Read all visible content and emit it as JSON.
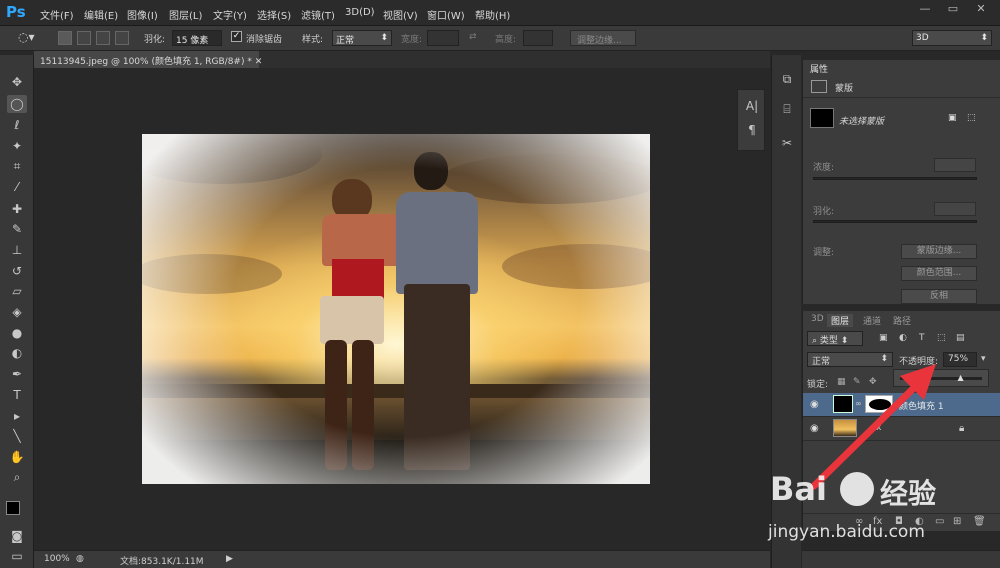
{
  "app": {
    "logo": "Ps",
    "accent": "#31a8ff"
  },
  "menu": [
    {
      "label": "文件(F)"
    },
    {
      "label": "编辑(E)"
    },
    {
      "label": "图像(I)"
    },
    {
      "label": "图层(L)"
    },
    {
      "label": "文字(Y)"
    },
    {
      "label": "选择(S)"
    },
    {
      "label": "滤镜(T)"
    },
    {
      "label": "3D(D)"
    },
    {
      "label": "视图(V)"
    },
    {
      "label": "窗口(W)"
    },
    {
      "label": "帮助(H)"
    }
  ],
  "window_controls": {
    "minimize": "—",
    "restore": "▭",
    "close": "✕"
  },
  "options": {
    "feather_label": "羽化:",
    "feather_value": "15 像素",
    "antialias_label": "消除锯齿",
    "antialias_checked": true,
    "style_label": "样式:",
    "style_value": "正常",
    "width_label": "宽度:",
    "height_label": "高度:",
    "refine_edge": "调整边缘...",
    "workspace": "3D"
  },
  "document": {
    "tab_label": "15113945.jpeg @ 100% (颜色填充 1, RGB/8#) *",
    "zoom": "100%",
    "doc_size": "文档:853.1K/1.11M"
  },
  "properties": {
    "tab": "属性",
    "mask_type": "蒙版",
    "mask_status": "未选择蒙版",
    "density_label": "浓度:",
    "feather_label": "羽化:",
    "adjust_label": "调整:",
    "mask_edge_button": "蒙版边缘...",
    "color_range_button": "颜色范围...",
    "invert_button": "反相"
  },
  "layers": {
    "tabs": [
      "3D",
      "图层",
      "通道",
      "路径"
    ],
    "active_tab": "图层",
    "filter_kind": "类型",
    "blend_mode": "正常",
    "opacity_label": "不透明度:",
    "opacity_value": "75%",
    "opacity_fraction": 0.75,
    "lock_label": "锁定:",
    "items": [
      {
        "name": "颜色填充 1",
        "selected": true
      },
      {
        "name": "",
        "selected": false
      }
    ]
  },
  "watermark": {
    "logo": "Bai",
    "logo_cn": "经验",
    "url": "jingyan.baidu.com"
  },
  "colors": {
    "arrow": "#e8343a",
    "selection": "#4d6a8c"
  }
}
